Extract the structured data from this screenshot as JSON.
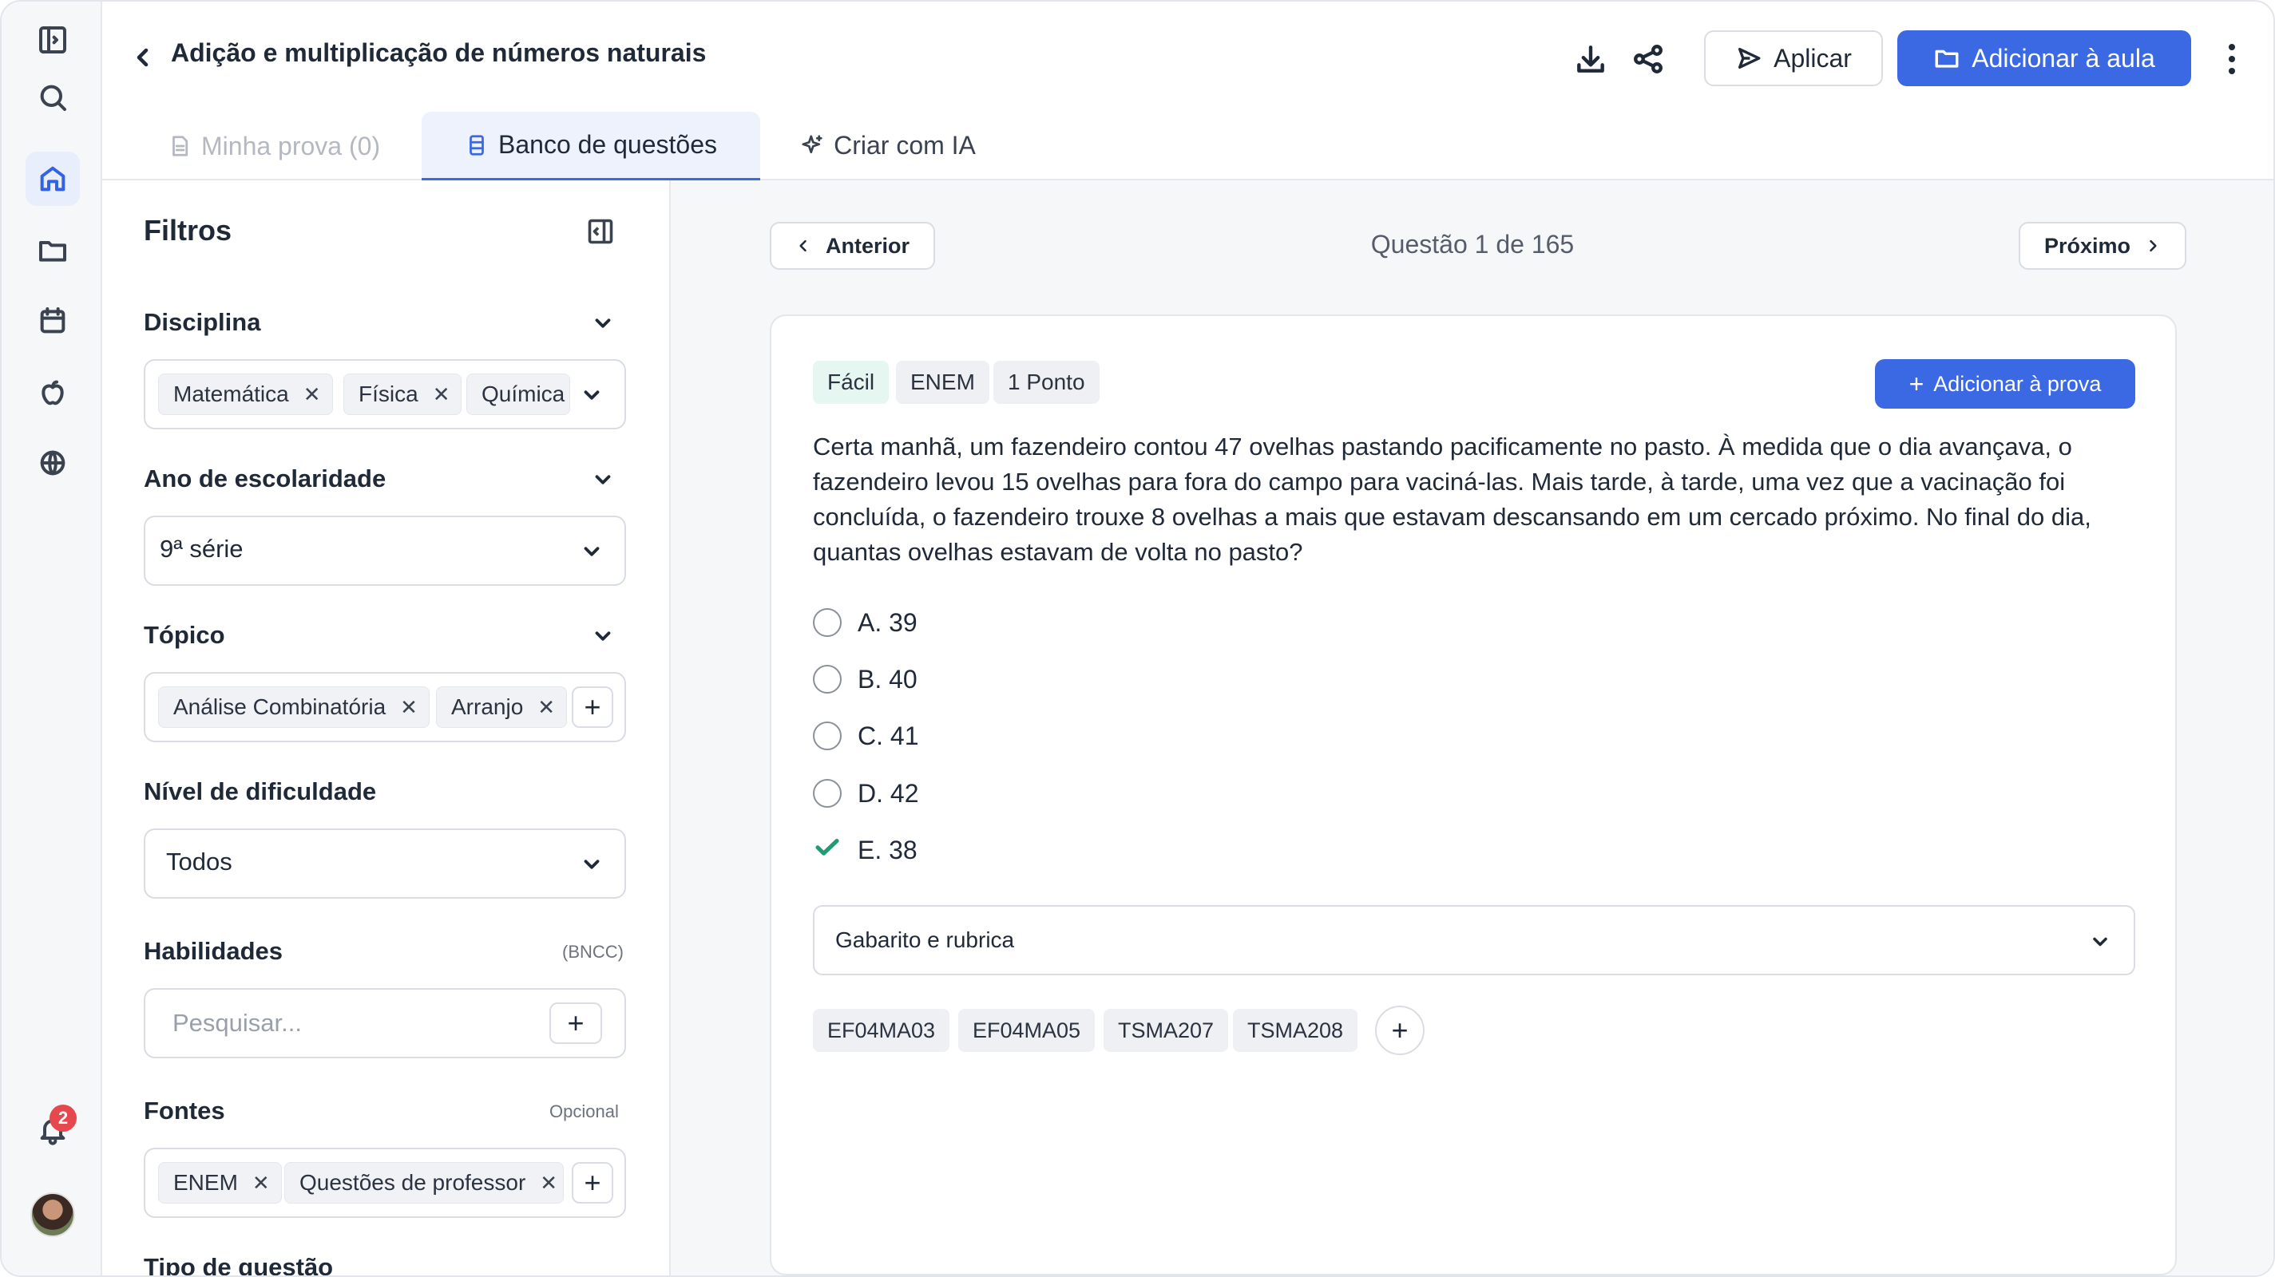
{
  "header": {
    "title": "Adição e multiplicação de números naturais",
    "apply_label": "Aplicar",
    "add_to_class_label": "Adicionar à aula"
  },
  "tabs": [
    {
      "label": "Minha prova (0)",
      "active": false
    },
    {
      "label": "Banco de questões",
      "active": true
    },
    {
      "label": "Criar com IA",
      "active": false
    }
  ],
  "rail": {
    "notification_count": "2"
  },
  "filters": {
    "title": "Filtros",
    "discipline": {
      "label": "Disciplina",
      "chips": [
        "Matemática",
        "Física",
        "Química"
      ]
    },
    "grade": {
      "label": "Ano de escolaridade",
      "value": "9ª série"
    },
    "topic": {
      "label": "Tópico",
      "chips": [
        "Análise Combinatória",
        "Arranjo"
      ]
    },
    "difficulty": {
      "label": "Nível de dificuldade",
      "value": "Todos"
    },
    "skills": {
      "label": "Habilidades",
      "note": "(BNCC)",
      "placeholder": "Pesquisar..."
    },
    "sources": {
      "label": "Fontes",
      "note": "Opcional",
      "chips": [
        "ENEM",
        "Questões de professor"
      ]
    },
    "question_type": {
      "label": "Tipo de questão"
    }
  },
  "main": {
    "prev_label": "Anterior",
    "next_label": "Próximo",
    "counter": "Questão 1 de 165",
    "question": {
      "tags": [
        "Fácil",
        "ENEM",
        "1 Ponto"
      ],
      "add_label": "Adicionar à prova",
      "text": "Certa manhã, um fazendeiro contou 47 ovelhas pastando pacificamente no pasto. À medida que o dia avançava, o fazendeiro levou 15 ovelhas para fora do campo para vaciná-las. Mais tarde, à tarde, uma vez que a vacinação foi concluída, o fazendeiro trouxe 8 ovelhas a mais que estavam descansando em um cercado próximo. No final do dia, quantas ovelhas estavam de volta no pasto?",
      "options": [
        "A. 39",
        "B. 40",
        "C. 41",
        "D. 42",
        "E. 38"
      ],
      "correct_index": 4,
      "rubric_label": "Gabarito e rubrica",
      "skills": [
        "EF04MA03",
        "EF04MA05",
        "TSMA207",
        "TSMA208"
      ]
    }
  },
  "colors": {
    "primary": "#3b68e3",
    "correct": "#1d9d74",
    "badge": "#e5484d"
  }
}
